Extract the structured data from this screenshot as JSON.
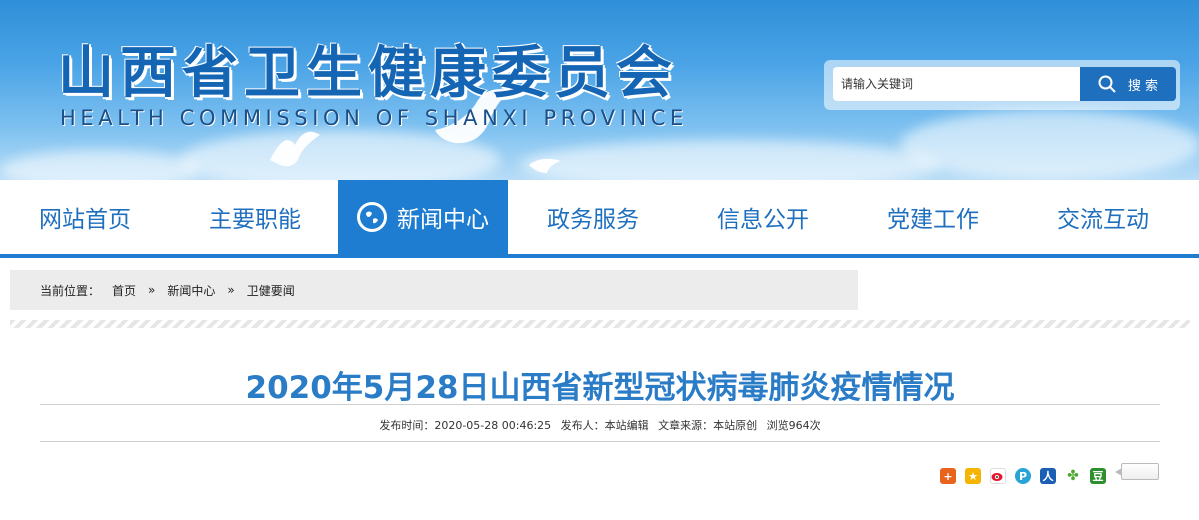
{
  "header": {
    "title": "山西省卫生健康委员会",
    "subtitle": "HEALTH COMMISSION OF SHANXI PROVINCE",
    "search_placeholder": "请输入关键词",
    "search_button": "搜 索"
  },
  "nav": {
    "items": [
      {
        "label": "网站首页"
      },
      {
        "label": "主要职能"
      },
      {
        "label": "新闻中心",
        "active": true
      },
      {
        "label": "政务服务"
      },
      {
        "label": "信息公开"
      },
      {
        "label": "党建工作"
      },
      {
        "label": "交流互动"
      }
    ]
  },
  "breadcrumb": {
    "prefix": "当前位置：",
    "items": [
      "首页",
      "新闻中心",
      "卫健要闻"
    ],
    "separator": "»"
  },
  "article": {
    "title": "2020年5月28日山西省新型冠状病毒肺炎疫情情况",
    "publish_time": "发布时间：2020-05-28 00:46:25",
    "publisher": "发布人：本站编辑",
    "source": "文章来源：本站原创",
    "views": "浏览964次"
  },
  "share": {
    "icons": [
      "share-more-icon",
      "qzone-icon",
      "weibo-icon",
      "tencent-weibo-icon",
      "renren-icon",
      "kaixin-icon",
      "douban-icon"
    ]
  },
  "colors": {
    "brand_blue": "#1f7dd1",
    "title_blue": "#2a7cc7"
  }
}
